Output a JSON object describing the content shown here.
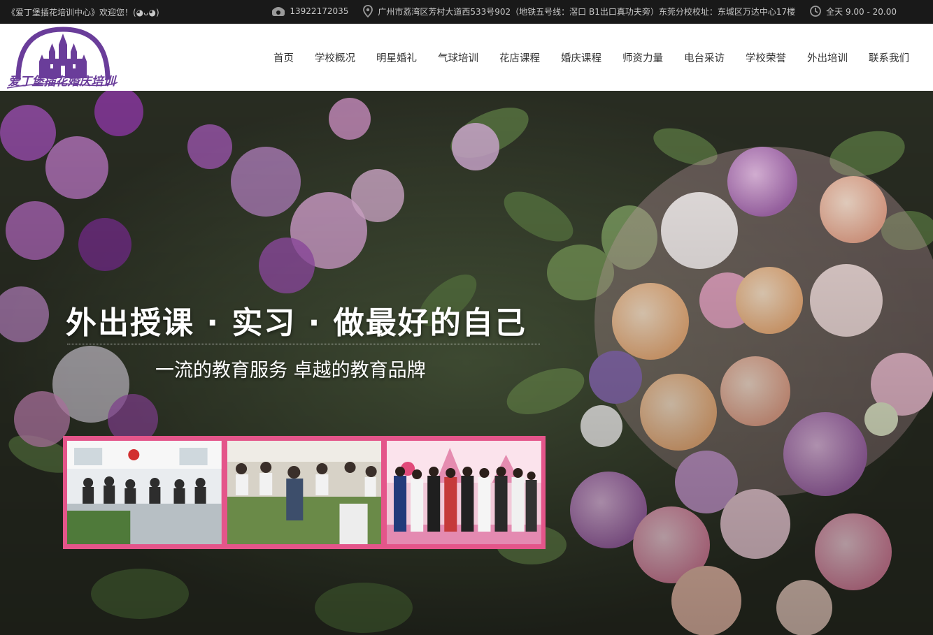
{
  "topbar": {
    "welcome": "《爱丁堡插花培训中心》欢迎您！(◕ᴗ◕)",
    "phone": "13922172035",
    "address": "广州市荔湾区芳村大道西533号902（地铁五号线：滘口 B1出口真功夫旁）东莞分校校址：东城区万达中心17楼",
    "hours": "全天 9.00 - 20.00",
    "icons": [
      "phone-icon",
      "location-pin-icon",
      "clock-icon"
    ]
  },
  "logo": {
    "text": "爱丁堡插花婚庆培训",
    "color": "#6a3d9a"
  },
  "nav": {
    "items": [
      "首页",
      "学校概况",
      "明星婚礼",
      "气球培训",
      "花店课程",
      "婚庆课程",
      "师资力量",
      "电台采访",
      "学校荣誉",
      "外出培训",
      "联系我们"
    ]
  },
  "hero": {
    "title": "外出授课 · 实习 · 做最好的自己",
    "subtitle": "一流的教育服务 卓越的教育品牌",
    "frame_color": "#e4558a"
  }
}
